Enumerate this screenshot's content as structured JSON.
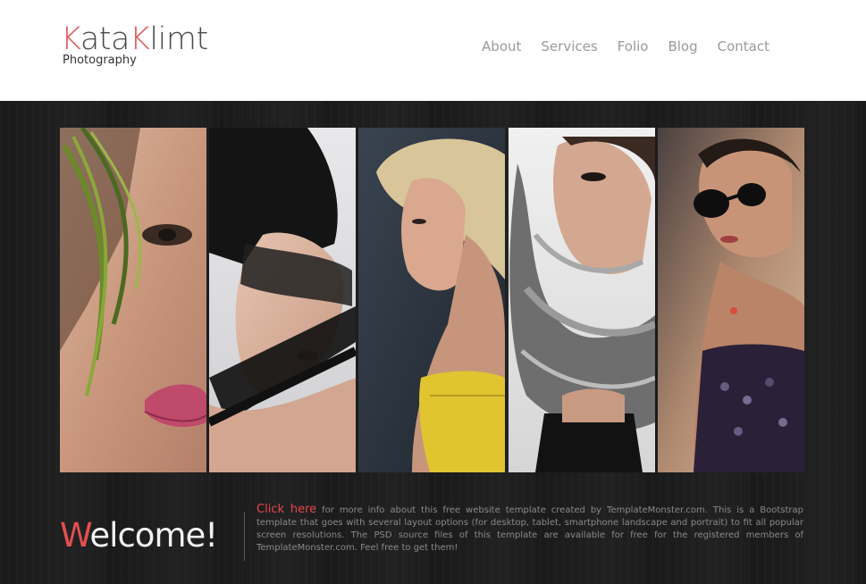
{
  "brand": {
    "title_first_initial": "K",
    "title_first_rest": "ata",
    "title_second_initial": "K",
    "title_second_rest": "limt",
    "subtitle": "Photography"
  },
  "nav": {
    "items": [
      {
        "label": "About"
      },
      {
        "label": "Services"
      },
      {
        "label": "Folio"
      },
      {
        "label": "Blog"
      },
      {
        "label": "Contact"
      }
    ]
  },
  "gallery": {
    "photos": [
      {
        "name": "portrait-green-feather"
      },
      {
        "name": "portrait-black-veil"
      },
      {
        "name": "portrait-blonde-profile"
      },
      {
        "name": "portrait-gray-ruffle"
      },
      {
        "name": "portrait-sunglasses"
      }
    ]
  },
  "welcome": {
    "initial": "W",
    "rest": "elcome!"
  },
  "intro": {
    "link_label": "Click here",
    "text": "for more info about this free website template created by TemplateMonster.com. This is a Bootstrap template that goes with several layout options (for desktop, tablet, smartphone landscape and portrait) to fit all popular screen resolutions. The PSD source files of this template are available for free for the registered members of TemplateMonster.com. Feel free to get them!"
  },
  "colors": {
    "accent": "#e05a5a",
    "header_bg": "#ffffff",
    "main_bg": "#1d1d1d"
  }
}
